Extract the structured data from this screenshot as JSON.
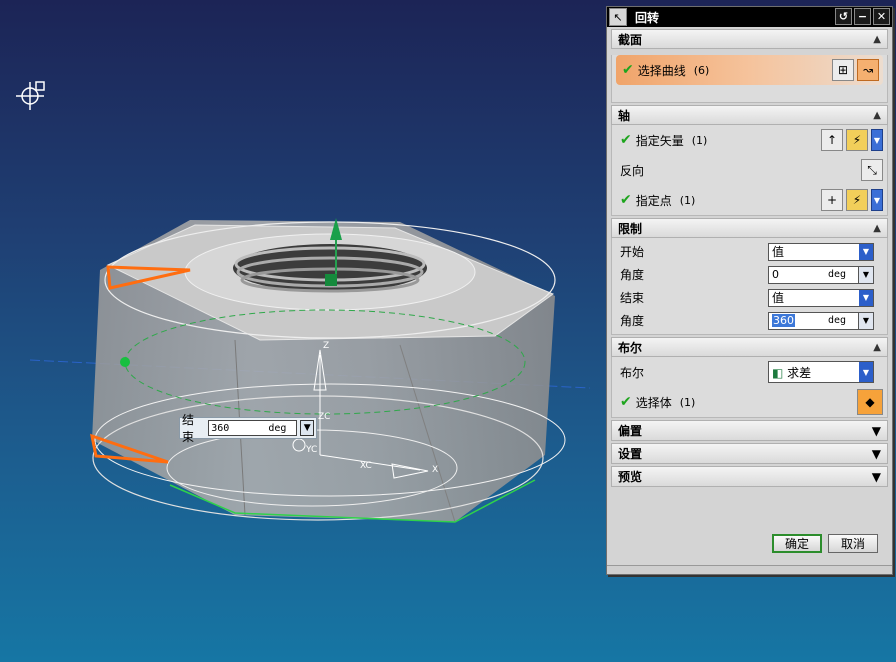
{
  "dialog": {
    "title": "回转",
    "icon": "arrow-cursor-icon",
    "section_section": {
      "title": "截面",
      "select_curve": "选择曲线",
      "select_count": "(6)"
    },
    "section_axis": {
      "title": "轴",
      "specify_vector": "指定矢量",
      "vector_count": "(1)",
      "reverse": "反向",
      "specify_point": "指定点",
      "point_count": "(1)"
    },
    "section_limits": {
      "title": "限制",
      "start_label": "开始",
      "start_type": "值",
      "start_angle_label": "角度",
      "start_angle": "0",
      "end_label": "结束",
      "end_type": "值",
      "end_angle_label": "角度",
      "end_angle": "360",
      "unit": "deg"
    },
    "section_boolean": {
      "title": "布尔",
      "boolean_label": "布尔",
      "boolean_value": "求差",
      "select_body": "选择体",
      "body_count": "(1)"
    },
    "collapsed": [
      "偏置",
      "设置",
      "预览"
    ],
    "ok": "确定",
    "cancel": "取消"
  },
  "floating_input": {
    "label": "结束",
    "value": "360",
    "unit": "deg"
  },
  "viewport": {
    "axis_labels": {
      "z": "Z",
      "zc": "ZC",
      "yc": "YC",
      "xc": "XC",
      "x": "X"
    }
  }
}
